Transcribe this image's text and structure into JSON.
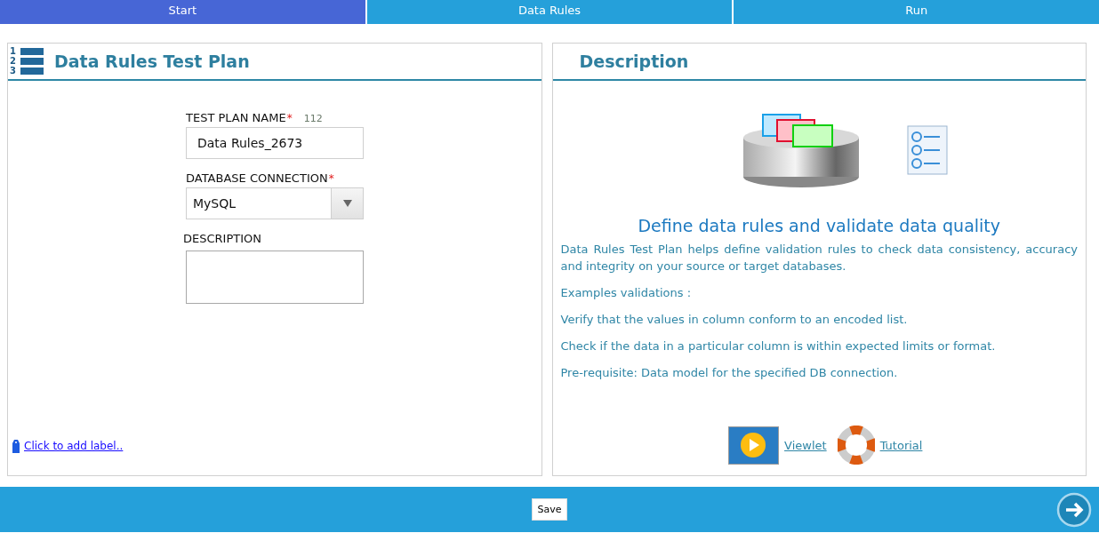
{
  "tabs": [
    {
      "label": "Start",
      "selected": true
    },
    {
      "label": "Data Rules",
      "selected": false
    },
    {
      "label": "Run",
      "selected": false
    }
  ],
  "left_panel": {
    "icon_numbers": [
      "1",
      "2",
      "3"
    ],
    "title": "Data Rules Test Plan",
    "fields": [
      {
        "kind": "text",
        "label": "TEST PLAN NAME",
        "required_mark": "*",
        "counter": "112",
        "value": "Data Rules_2673"
      },
      {
        "kind": "dropdown",
        "label": "DATABASE CONNECTION",
        "required_mark": "*",
        "value": "MySQL"
      },
      {
        "kind": "textarea",
        "label": "DESCRIPTION"
      }
    ],
    "label_link": "Click to add label.."
  },
  "right_panel": {
    "title": "Description",
    "heading": "Define data rules and validate data quality",
    "paragraphs": [
      "Data Rules Test Plan helps define validation rules to check data consistency, accuracy and integrity on your source or target databases.",
      "Examples validations :",
      "Verify that the values in column conform to an encoded list.",
      "Check if the data in a particular column is within expected limits or format.",
      "Pre-requisite: Data model for the specified DB connection."
    ],
    "links": [
      {
        "kind": "video",
        "label": "Viewlet"
      },
      {
        "kind": "help",
        "label": "Tutorial"
      }
    ]
  },
  "footer": {
    "save_button": "Save"
  }
}
